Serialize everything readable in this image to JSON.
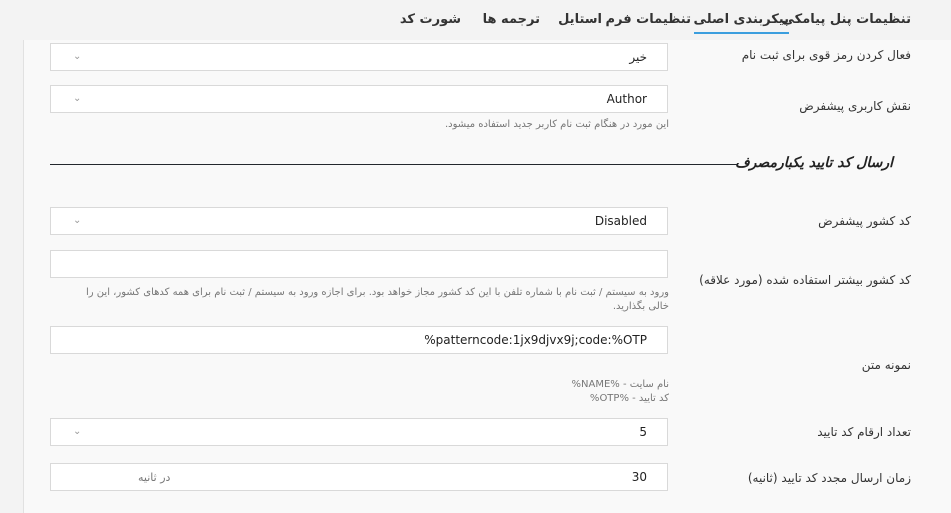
{
  "tabs": [
    {
      "label": "تنظیمات پنل پیامکی"
    },
    {
      "label": "پیکربندی اصلی"
    },
    {
      "label": "تنظیمات فرم"
    },
    {
      "label": "استایل"
    },
    {
      "label": "ترجمه ها"
    },
    {
      "label": "شورت کد"
    }
  ],
  "fields": {
    "strong_password": {
      "label": "فعال کردن رمز قوی برای ثبت نام",
      "value": "خیر"
    },
    "default_role": {
      "label": "نقش کاربری پیشفرض",
      "value": "Author",
      "help": "این مورد در هنگام ثبت نام کاربر جدید استفاده میشود."
    },
    "country_code": {
      "label": "کد کشور پیشفرض",
      "value": "Disabled"
    },
    "allowed_countries": {
      "label": "کد کشور بیشتر استفاده شده (مورد علاقه)",
      "value": "",
      "help_line1": "ورود به سیستم / ثبت نام با شماره تلفن با این کد کشور مجاز خواهد بود. برای اجازه ورود به سیستم / ثبت نام برای همه کدهای کشور، این را",
      "help_line2": "خالی بگذارید."
    },
    "sample_text": {
      "label": "نمونه متن",
      "value": "%patterncode:1jx9djvx9j;code:%OTP",
      "help_line1": "نام سایت - %NAME%",
      "help_line2": "کد تایید - %OTP%"
    },
    "otp_digits": {
      "label": "تعداد ارقام کد تایید",
      "value": "5"
    },
    "resend_time": {
      "label": "زمان ارسال مجدد کد تایید (ثانیه)",
      "value": "30",
      "suffix": "در ثانیه"
    }
  },
  "section": {
    "title": "ارسال کد تایید یکبارمصرف"
  }
}
